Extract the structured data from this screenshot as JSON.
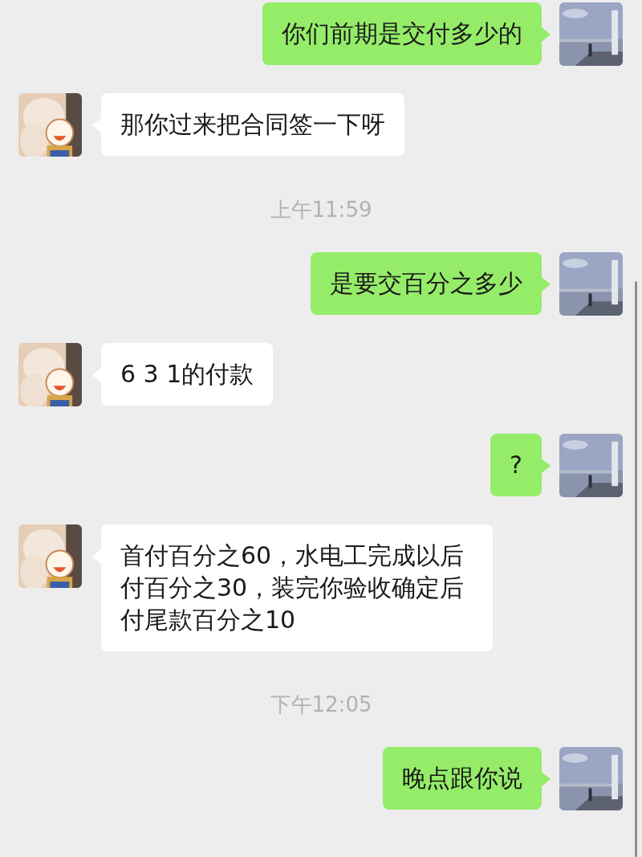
{
  "messages": [
    {
      "kind": "sent",
      "text": "你们前期是交付多少的"
    },
    {
      "kind": "received",
      "text": "那你过来把合同签一下呀"
    },
    {
      "kind": "time",
      "text": "上午11:59"
    },
    {
      "kind": "sent",
      "text": "是要交百分之多少"
    },
    {
      "kind": "received",
      "text": "6 3 1的付款"
    },
    {
      "kind": "sent",
      "text": "?"
    },
    {
      "kind": "received",
      "text": "首付百分之60，水电工完成以后付百分之30，装完你验收确定后付尾款百分之10"
    },
    {
      "kind": "time",
      "text": "下午12:05"
    },
    {
      "kind": "sent",
      "text": "晚点跟你说"
    }
  ]
}
